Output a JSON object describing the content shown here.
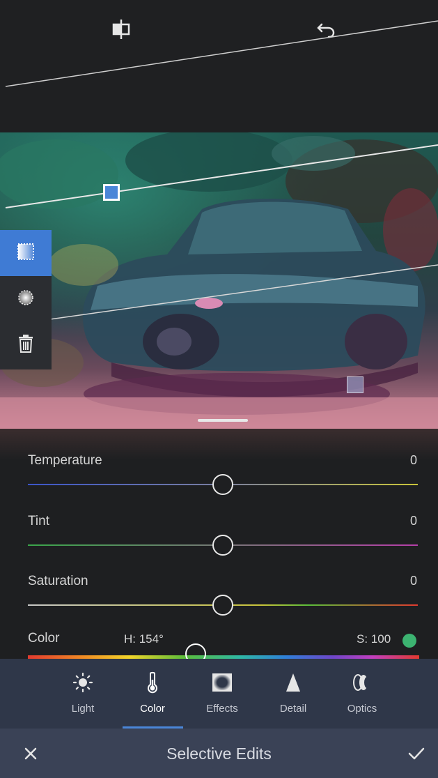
{
  "toolbar": {
    "compare_icon": "compare-icon",
    "undo_icon": "undo-icon"
  },
  "mask_tools": [
    {
      "icon": "linear-gradient-icon",
      "active": true
    },
    {
      "icon": "radial-gradient-icon",
      "active": false
    },
    {
      "icon": "trash-icon",
      "active": false
    }
  ],
  "sliders": {
    "temperature": {
      "label": "Temperature",
      "value": "0",
      "level": 0.5,
      "track_colors": [
        "#3b55c9",
        "#c9c43a"
      ]
    },
    "tint": {
      "label": "Tint",
      "value": "0",
      "level": 0.5,
      "track_colors": [
        "#3aa54a",
        "#b53fa8"
      ]
    },
    "saturation": {
      "label": "Saturation",
      "value": "0",
      "level": 0.5,
      "track_colors": [
        "#c8c8c8",
        "#e23a2f"
      ]
    }
  },
  "color": {
    "label": "Color",
    "hue": "H: 154°",
    "saturation": "S: 100",
    "swatch_color": "#3cb371",
    "hue_level": 0.43
  },
  "tabs": [
    {
      "label": "Light",
      "icon": "sun-icon",
      "active": false
    },
    {
      "label": "Color",
      "icon": "thermometer-icon",
      "active": true
    },
    {
      "label": "Effects",
      "icon": "vignette-icon",
      "active": false
    },
    {
      "label": "Detail",
      "icon": "triangle-icon",
      "active": false
    },
    {
      "label": "Optics",
      "icon": "lens-icon",
      "active": false
    }
  ],
  "bottom_bar": {
    "title": "Selective Edits",
    "close_icon": "close-icon",
    "done_icon": "checkmark-icon"
  },
  "colors": {
    "accent": "#4a86d8",
    "tab_bar": "#2f3749",
    "bottom_bar": "#3a4256"
  }
}
